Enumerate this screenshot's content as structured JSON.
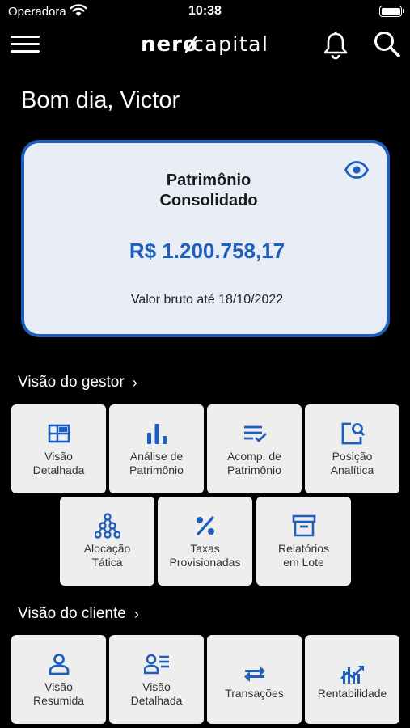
{
  "status_bar": {
    "carrier": "Operadora",
    "time": "10:38"
  },
  "nav": {
    "logo_part1": "nero",
    "logo_part2": "capital"
  },
  "greeting": "Bom dia, Victor",
  "card": {
    "title_line1": "Patrimônio",
    "title_line2": "Consolidado",
    "value": "R$ 1.200.758,17",
    "subtitle": "Valor bruto até 18/10/2022"
  },
  "colors": {
    "accent": "#1e5fbd",
    "card_bg": "#e9eef6",
    "tile_bg": "#eeeeee",
    "background": "#000000"
  },
  "gestor": {
    "title": "Visão do gestor",
    "tiles": [
      {
        "icon": "detailed-view-icon",
        "line1": "Visão",
        "line2": "Detalhada"
      },
      {
        "icon": "bar-chart-icon",
        "line1": "Análise de",
        "line2": "Patrimônio"
      },
      {
        "icon": "checklist-icon",
        "line1": "Acomp. de",
        "line2": "Patrimônio"
      },
      {
        "icon": "document-search-icon",
        "line1": "Posição",
        "line2": "Analítica"
      },
      {
        "icon": "network-tree-icon",
        "line1": "Alocação",
        "line2": "Tática"
      },
      {
        "icon": "percent-icon",
        "line1": "Taxas",
        "line2": "Provisionadas"
      },
      {
        "icon": "archive-box-icon",
        "line1": "Relatórios",
        "line2": "em Lote"
      }
    ]
  },
  "cliente": {
    "title": "Visão do cliente",
    "tiles": [
      {
        "icon": "person-icon",
        "line1": "Visão",
        "line2": "Resumida"
      },
      {
        "icon": "person-list-icon",
        "line1": "Visão",
        "line2": "Detalhada"
      },
      {
        "icon": "swap-arrows-icon",
        "line1": "Transações"
      },
      {
        "icon": "trending-chart-icon",
        "line1": "Rentabilidade"
      }
    ]
  }
}
